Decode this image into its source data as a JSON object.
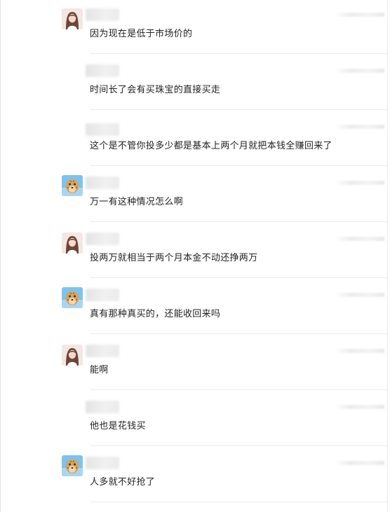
{
  "messages": [
    {
      "avatar": "woman-avatar-icon",
      "text": "因为现在是低于市场价的"
    },
    {
      "avatar": "none",
      "text": "时间长了会有买珠宝的直接买走"
    },
    {
      "avatar": "none",
      "text": "这个是不管你投多少都是基本上两个月就把本钱全赚回来了"
    },
    {
      "avatar": "cheetah-avatar-icon",
      "text": "万一有这种情况怎么啊"
    },
    {
      "avatar": "woman-avatar-icon",
      "text": "投两万就相当于两个月本金不动还挣两万"
    },
    {
      "avatar": "cheetah-avatar-icon",
      "text": "真有那种真买的，还能收回来吗"
    },
    {
      "avatar": "woman-avatar-icon",
      "text": "能啊"
    },
    {
      "avatar": "none",
      "text": "他也是花钱买"
    },
    {
      "avatar": "cheetah-avatar-icon",
      "text": "人多就不好抢了"
    }
  ],
  "colors": {
    "text": "#222222",
    "divider": "#ececec",
    "background": "#ffffff"
  }
}
